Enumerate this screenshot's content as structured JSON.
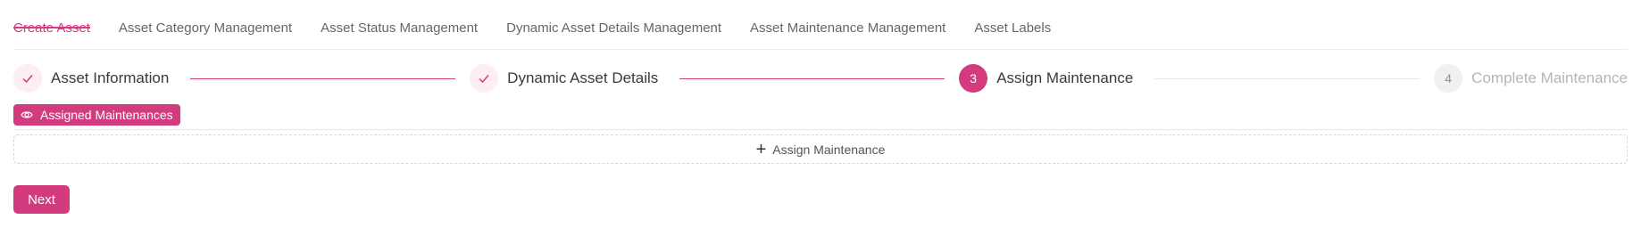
{
  "tabs": [
    {
      "label": "Create Asset",
      "active": true
    },
    {
      "label": "Asset Category Management"
    },
    {
      "label": "Asset Status Management"
    },
    {
      "label": "Dynamic Asset Details Management"
    },
    {
      "label": "Asset Maintenance Management"
    },
    {
      "label": "Asset Labels"
    }
  ],
  "steps": [
    {
      "icon": "check-icon",
      "title": "Asset Information",
      "state": "done"
    },
    {
      "icon": "check-icon",
      "title": "Dynamic Asset Details",
      "state": "done"
    },
    {
      "number": "3",
      "title": "Assign Maintenance",
      "state": "current"
    },
    {
      "number": "4",
      "title": "Complete Maintenance",
      "state": "pending"
    }
  ],
  "assigned_tag": {
    "icon": "eye-icon",
    "label": "Assigned Maintenances"
  },
  "assign_button": {
    "icon": "plus-icon",
    "label": "Assign Maintenance"
  },
  "next_button": {
    "label": "Next"
  },
  "colors": {
    "accent": "#d23b7e",
    "done_bg": "#fdeef4",
    "pending_bg": "#f0f0f0"
  }
}
